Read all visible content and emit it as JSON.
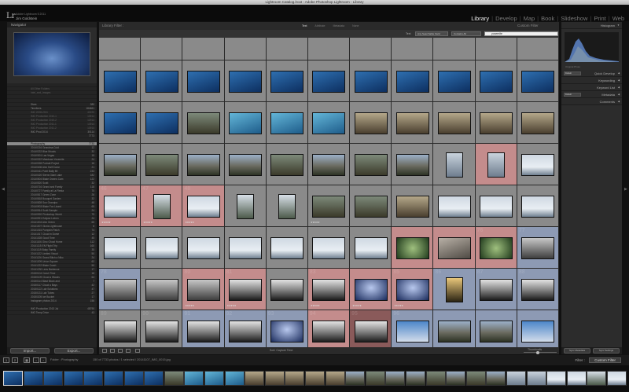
{
  "window_title": "Lightroom Catalog.lrcat - Adobe Photoshop Lightroom - Library",
  "identity": {
    "logo": "Lr",
    "product_line": "Adobe Lightroom 5 2011",
    "user_name": "Jim Goldstein"
  },
  "modules": [
    {
      "label": "Library",
      "active": true
    },
    {
      "label": "Develop",
      "active": false
    },
    {
      "label": "Map",
      "active": false
    },
    {
      "label": "Book",
      "active": false
    },
    {
      "label": "Slideshow",
      "active": false
    },
    {
      "label": "Print",
      "active": false
    },
    {
      "label": "Web",
      "active": false
    }
  ],
  "left_panel": {
    "navigator_title": "Navigator",
    "folders": [
      {
        "label": "",
        "count": "",
        "state": "dim"
      },
      {
        "label": "All Other Folders",
        "count": "",
        "state": "dim"
      },
      {
        "label": "Intel_and_Images",
        "count": "",
        "state": "dim"
      },
      {
        "label": "",
        "count": "",
        "state": "dim"
      },
      {
        "label": "",
        "count": "",
        "state": "normal"
      },
      {
        "label": "Stars",
        "count": "380",
        "state": "normal"
      },
      {
        "label": "Timelines",
        "count": "184661",
        "state": "normal"
      },
      {
        "label": "IMG 2008-2011",
        "count": "40190",
        "state": "dim"
      },
      {
        "label": "IMG Production 2010-1",
        "count": "13914",
        "state": "dim"
      },
      {
        "label": "IMG Production 2010-2",
        "count": "12914",
        "state": "dim"
      },
      {
        "label": "IMG Production 2011-1",
        "count": "13914",
        "state": "dim"
      },
      {
        "label": "IMG Production 2011-2",
        "count": "13914",
        "state": "dim"
      },
      {
        "label": "IMG Prod 2014",
        "count": "30114",
        "state": "normal"
      },
      {
        "label": "",
        "count": "7773",
        "state": "normal"
      },
      {
        "label": "",
        "count": "",
        "state": "normal"
      },
      {
        "label": "Photography",
        "count": "7733",
        "state": "selected"
      },
      {
        "label": "20140216 Grandma Cold",
        "count": "12",
        "state": "normal"
      },
      {
        "label": "20140222 Blue Moods",
        "count": "32",
        "state": "normal"
      },
      {
        "label": "20140301 Las Vegas",
        "count": "15",
        "state": "normal"
      },
      {
        "label": "20140322 Meadows Yosemite",
        "count": "24",
        "state": "normal"
      },
      {
        "label": "20140328 Portrait Project",
        "count": "16",
        "state": "normal"
      },
      {
        "label": "20140406 Alex Half Dome",
        "count": "21",
        "state": "normal"
      },
      {
        "label": "20140411 Point Bally Mt",
        "count": "233",
        "state": "normal"
      },
      {
        "label": "20140420 Sierra Giant Lake",
        "count": "182",
        "state": "normal"
      },
      {
        "label": "20140504 Blake Owens Cam",
        "count": "122",
        "state": "normal"
      },
      {
        "label": "20140520 Scott",
        "count": "32",
        "state": "normal"
      },
      {
        "label": "20140716 Grand and Family",
        "count": "118",
        "state": "normal"
      },
      {
        "label": "20140727 Family at La Fiesta",
        "count": "70",
        "state": "normal"
      },
      {
        "label": "20140817 Green Zone",
        "count": "26",
        "state": "normal"
      },
      {
        "label": "20140818 Bouquet Garden",
        "count": "32",
        "state": "normal"
      },
      {
        "label": "20140828 Sun Grandpa",
        "count": "48",
        "state": "normal"
      },
      {
        "label": "20140903 Blake Fox Lizard",
        "count": "65",
        "state": "normal"
      },
      {
        "label": "20140914 Scott Sample",
        "count": "24",
        "state": "normal"
      },
      {
        "label": "20140920 Photoshop World",
        "count": "75",
        "state": "normal"
      },
      {
        "label": "20140921 Eclipse Lichen",
        "count": "24",
        "state": "normal"
      },
      {
        "label": "20141004 Alex Green",
        "count": "65",
        "state": "normal"
      },
      {
        "label": "20141007 Gloria Lighthouse",
        "count": "8",
        "state": "normal"
      },
      {
        "label": "20141015 Pumpkin Patch",
        "count": "74",
        "state": "normal"
      },
      {
        "label": "20141017 Cloud in Dome",
        "count": "12",
        "state": "normal"
      },
      {
        "label": "20141028 Good Time",
        "count": "45",
        "state": "normal"
      },
      {
        "label": "20141106 Gino Ghost Home",
        "count": "112",
        "state": "normal"
      },
      {
        "label": "20141115 EN Flight Trip",
        "count": "160",
        "state": "normal"
      },
      {
        "label": "20141119 Bday Family",
        "count": "35",
        "state": "normal"
      },
      {
        "label": "20141122 Limited Visual",
        "count": "50",
        "state": "normal"
      },
      {
        "label": "20141126 Grand Bitch a Niko",
        "count": "24",
        "state": "normal"
      },
      {
        "label": "20141209 Union Square",
        "count": "62",
        "state": "normal"
      },
      {
        "label": "20141222 Blake Crash",
        "count": "50",
        "state": "normal"
      },
      {
        "label": "20141230 Lens Barbecue",
        "count": "17",
        "state": "normal"
      },
      {
        "label": "20150104 Crash Time",
        "count": "18",
        "state": "normal"
      },
      {
        "label": "20150109 Cloud a Woods",
        "count": "64",
        "state": "normal"
      },
      {
        "label": "20150114 Blast Block and",
        "count": "7",
        "state": "normal"
      },
      {
        "label": "20150117 Cloud a Bays",
        "count": "42",
        "state": "normal"
      },
      {
        "label": "20150122 Lab Solutions",
        "count": "47",
        "state": "normal"
      },
      {
        "label": "20150131 Lab Tubes",
        "count": "27",
        "state": "normal"
      },
      {
        "label": "20150205 Ice Bucket",
        "count": "17",
        "state": "normal"
      },
      {
        "label": "Instagram photos 2014",
        "count": "156",
        "state": "normal"
      },
      {
        "label": "",
        "count": "",
        "state": "normal"
      },
      {
        "label": "IMG Production 2013 Jul",
        "count": "48790",
        "state": "normal"
      },
      {
        "label": "IMG Temp Drive",
        "count": "43",
        "state": "normal"
      }
    ],
    "import_label": "Import...",
    "export_label": "Export..."
  },
  "filter_bar": {
    "title": "Library Filter :",
    "options": [
      {
        "label": "Text",
        "active": true
      },
      {
        "label": "Attribute",
        "active": false
      },
      {
        "label": "Metadata",
        "active": false
      },
      {
        "label": "None",
        "active": false
      }
    ],
    "custom_filter": "Custom Filter",
    "text_label": "Text",
    "field_dropdown": "Any Searchable Field",
    "rule_dropdown": "Contains All",
    "search_value": "yosemite"
  },
  "right_panel": {
    "histogram_title": "Histogram",
    "original_photo_label": "Original Photo",
    "sections": [
      {
        "label": "Quick Develop",
        "dropdown": "Default"
      },
      {
        "label": "Keywording",
        "dropdown": ""
      },
      {
        "label": "Keyword List",
        "dropdown": ""
      },
      {
        "label": "Metadata",
        "dropdown": "Default"
      },
      {
        "label": "Comments",
        "dropdown": ""
      }
    ],
    "sync_label": "Sync Metadata",
    "sync_settings_label": "Sync Settings"
  },
  "toolbar": {
    "sort_label": "Sort:",
    "sort_value": "Capture Time",
    "thumbnails_label": "Thumbnails"
  },
  "secondary_bar": {
    "page_left": "1",
    "page_right": "2",
    "path": "Folder : Photography",
    "count_info": "150 of 7733 photos / 1 selected / 20141107_IMG_0015.jpg",
    "filter_label": "Filter :",
    "filter_value": "Custom Filter"
  },
  "grid": {
    "cols": 11,
    "rows": 8,
    "cells": [
      {
        "n": "",
        "bg": "#8a8a8a",
        "thumb": "none",
        "stars": ""
      },
      {
        "n": "",
        "bg": "#8a8a8a",
        "thumb": "none",
        "stars": ""
      },
      {
        "n": "",
        "bg": "#8a8a8a",
        "thumb": "none",
        "stars": ""
      },
      {
        "n": "",
        "bg": "#8a8a8a",
        "thumb": "none",
        "stars": ""
      },
      {
        "n": "",
        "bg": "#8a8a8a",
        "thumb": "none",
        "stars": ""
      },
      {
        "n": "",
        "bg": "#8a8a8a",
        "thumb": "none",
        "stars": ""
      },
      {
        "n": "",
        "bg": "#8a8a8a",
        "thumb": "none",
        "stars": ""
      },
      {
        "n": "",
        "bg": "#8a8a8a",
        "thumb": "none",
        "stars": ""
      },
      {
        "n": "",
        "bg": "#8a8a8a",
        "thumb": "none",
        "stars": ""
      },
      {
        "n": "",
        "bg": "#8a8a8a",
        "thumb": "none",
        "stars": ""
      },
      {
        "n": "",
        "bg": "#8a8a8a",
        "thumb": "none",
        "stars": ""
      },
      {
        "n": "",
        "bg": "#8a8a8a",
        "thumb": "water",
        "stars": ""
      },
      {
        "n": "",
        "bg": "#8a8a8a",
        "thumb": "water",
        "stars": ""
      },
      {
        "n": "",
        "bg": "#8a8a8a",
        "thumb": "water",
        "stars": ""
      },
      {
        "n": "",
        "bg": "#8a8a8a",
        "thumb": "water",
        "stars": ""
      },
      {
        "n": "",
        "bg": "#8a8a8a",
        "thumb": "water",
        "stars": ""
      },
      {
        "n": "",
        "bg": "#8a8a8a",
        "thumb": "water",
        "stars": ""
      },
      {
        "n": "",
        "bg": "#8a8a8a",
        "thumb": "water",
        "stars": ""
      },
      {
        "n": "",
        "bg": "#8a8a8a",
        "thumb": "water",
        "stars": ""
      },
      {
        "n": "",
        "bg": "#8a8a8a",
        "thumb": "water",
        "stars": ""
      },
      {
        "n": "",
        "bg": "#8a8a8a",
        "thumb": "water",
        "stars": ""
      },
      {
        "n": "",
        "bg": "#8a8a8a",
        "thumb": "water",
        "stars": ""
      },
      {
        "n": "",
        "bg": "#8a8a8a",
        "thumb": "water",
        "stars": ""
      },
      {
        "n": "",
        "bg": "#8a8a8a",
        "thumb": "water",
        "stars": ""
      },
      {
        "n": "",
        "bg": "#8a8a8a",
        "thumb": "people",
        "stars": ""
      },
      {
        "n": "",
        "bg": "#8a8a8a",
        "thumb": "aqua",
        "stars": ""
      },
      {
        "n": "",
        "bg": "#8a8a8a",
        "thumb": "aqua",
        "stars": ""
      },
      {
        "n": "",
        "bg": "#8a8a8a",
        "thumb": "aqua",
        "stars": ""
      },
      {
        "n": "",
        "bg": "#8a8a8a",
        "thumb": "room",
        "stars": ""
      },
      {
        "n": "",
        "bg": "#8a8a8a",
        "thumb": "room",
        "stars": ""
      },
      {
        "n": "",
        "bg": "#8a8a8a",
        "thumb": "room",
        "stars": ""
      },
      {
        "n": "",
        "bg": "#8a8a8a",
        "thumb": "room",
        "stars": ""
      },
      {
        "n": "",
        "bg": "#8a8a8a",
        "thumb": "room",
        "stars": ""
      },
      {
        "n": "",
        "bg": "#8a8a8a",
        "thumb": "valley",
        "stars": ""
      },
      {
        "n": "",
        "bg": "#8a8a8a",
        "thumb": "people",
        "stars": ""
      },
      {
        "n": "",
        "bg": "#8a8a8a",
        "thumb": "valley",
        "stars": ""
      },
      {
        "n": "",
        "bg": "#8a8a8a",
        "thumb": "valley",
        "stars": ""
      },
      {
        "n": "",
        "bg": "#8a8a8a",
        "thumb": "people",
        "stars": ""
      },
      {
        "n": "",
        "bg": "#8a8a8a",
        "thumb": "valley",
        "stars": ""
      },
      {
        "n": "",
        "bg": "#8a8a8a",
        "thumb": "people",
        "stars": ""
      },
      {
        "n": "",
        "bg": "#8a8a8a",
        "thumb": "valley",
        "stars": ""
      },
      {
        "n": "",
        "bg": "#8a8a8a",
        "thumb": "fog",
        "stars": ""
      },
      {
        "n": "",
        "bg": "#c48c8c",
        "thumb": "fog",
        "stars": ""
      },
      {
        "n": "",
        "bg": "#8a8a8a",
        "thumb": "snow",
        "stars": ""
      },
      {
        "n": "46",
        "bg": "#c48c8c",
        "thumb": "snow",
        "stars": "★★★★★"
      },
      {
        "n": "47",
        "bg": "#c48c8c",
        "thumb": "snowp",
        "stars": "★★★★★"
      },
      {
        "n": "48",
        "bg": "#c48c8c",
        "thumb": "snow",
        "stars": "★★★★★"
      },
      {
        "n": "",
        "bg": "#8a8a8a",
        "thumb": "snowp",
        "stars": ""
      },
      {
        "n": "",
        "bg": "#8a8a8a",
        "thumb": "snowp",
        "stars": ""
      },
      {
        "n": "",
        "bg": "#8a8a8a",
        "thumb": "people",
        "stars": "★★★★★"
      },
      {
        "n": "",
        "bg": "#8a8a8a",
        "thumb": "people",
        "stars": ""
      },
      {
        "n": "",
        "bg": "#8a8a8a",
        "thumb": "room",
        "stars": ""
      },
      {
        "n": "",
        "bg": "#8a8a8a",
        "thumb": "snow",
        "stars": ""
      },
      {
        "n": "",
        "bg": "#8a8a8a",
        "thumb": "snow",
        "stars": ""
      },
      {
        "n": "",
        "bg": "#8a8a8a",
        "thumb": "snow",
        "stars": ""
      },
      {
        "n": "",
        "bg": "#8a8a8a",
        "thumb": "snow",
        "stars": ""
      },
      {
        "n": "",
        "bg": "#8a8a8a",
        "thumb": "snow",
        "stars": ""
      },
      {
        "n": "",
        "bg": "#8a8a8a",
        "thumb": "snow",
        "stars": ""
      },
      {
        "n": "",
        "bg": "#8a8a8a",
        "thumb": "snow",
        "stars": ""
      },
      {
        "n": "",
        "bg": "#8a8a8a",
        "thumb": "snow",
        "stars": ""
      },
      {
        "n": "",
        "bg": "#8a8a8a",
        "thumb": "snow",
        "stars": ""
      },
      {
        "n": "",
        "bg": "#8a8a8a",
        "thumb": "snow",
        "stars": ""
      },
      {
        "n": "",
        "bg": "#c48c8c",
        "thumb": "tree",
        "stars": ""
      },
      {
        "n": "",
        "bg": "#c48c8c",
        "thumb": "rock",
        "stars": ""
      },
      {
        "n": "76",
        "bg": "#c48c8c",
        "thumb": "tree",
        "stars": ""
      },
      {
        "n": "77",
        "bg": "#8d9ab4",
        "thumb": "stone",
        "stars": ""
      },
      {
        "n": "78",
        "bg": "#8d9ab4",
        "thumb": "stone",
        "stars": ""
      },
      {
        "n": "",
        "bg": "#8a8a8a",
        "thumb": "stone",
        "stars": ""
      },
      {
        "n": "80",
        "bg": "#c48c8c",
        "thumb": "stone",
        "stars": "★★★★★"
      },
      {
        "n": "81",
        "bg": "#c48c8c",
        "thumb": "bw",
        "stars": "★★★★★"
      },
      {
        "n": "",
        "bg": "#8a8a8a",
        "thumb": "bw",
        "stars": ""
      },
      {
        "n": "83",
        "bg": "#c48c8c",
        "thumb": "bw",
        "stars": "★★★★★"
      },
      {
        "n": "",
        "bg": "#c48c8c",
        "thumb": "dusk",
        "stars": "★★★★★"
      },
      {
        "n": "85",
        "bg": "#c48c8c",
        "thumb": "dusk",
        "stars": "★★★★★"
      },
      {
        "n": "86",
        "bg": "#8d9ab4",
        "thumb": "lamp",
        "stars": ""
      },
      {
        "n": "87",
        "bg": "#8d9ab4",
        "thumb": "bw",
        "stars": ""
      },
      {
        "n": "88",
        "bg": "#8d9ab4",
        "thumb": "bw",
        "stars": ""
      },
      {
        "n": "89",
        "bg": "#8a8a8a",
        "thumb": "bw",
        "stars": ""
      },
      {
        "n": "90",
        "bg": "#8a8a8a",
        "thumb": "bw",
        "stars": ""
      },
      {
        "n": "91",
        "bg": "#8d9ab4",
        "thumb": "bw",
        "stars": ""
      },
      {
        "n": "92",
        "bg": "#8d9ab4",
        "thumb": "bw",
        "stars": ""
      },
      {
        "n": "93",
        "bg": "#8d9ab4",
        "thumb": "dusk",
        "stars": ""
      },
      {
        "n": "94",
        "bg": "#c48c8c",
        "thumb": "bw",
        "stars": ""
      },
      {
        "n": "95",
        "bg": "#8a5a5a",
        "thumb": "bw",
        "stars": ""
      },
      {
        "n": "96",
        "bg": "#8d9ab4",
        "thumb": "sky",
        "stars": ""
      },
      {
        "n": "",
        "bg": "#8d9ab4",
        "thumb": "valley",
        "stars": ""
      },
      {
        "n": "",
        "bg": "#8d9ab4",
        "thumb": "valley",
        "stars": ""
      },
      {
        "n": "",
        "bg": "#8d9ab4",
        "thumb": "sky",
        "stars": ""
      }
    ]
  },
  "filmstrip": {
    "items": [
      "water",
      "water",
      "water",
      "water",
      "water",
      "water",
      "water",
      "water",
      "people",
      "aqua",
      "aqua",
      "aqua",
      "room",
      "room",
      "room",
      "room",
      "room",
      "valley",
      "people",
      "valley",
      "valley",
      "people",
      "valley",
      "people",
      "valley",
      "fog",
      "fog",
      "snow",
      "snow",
      "snowp",
      "snow"
    ]
  },
  "colors": {
    "accent": "#eeeeee",
    "panel": "#2c2c2c",
    "grid_bg": "#3d3d3d",
    "cell_default": "#8a8a8a",
    "label_red": "#c48c8c",
    "label_blue": "#8d9ab4"
  }
}
